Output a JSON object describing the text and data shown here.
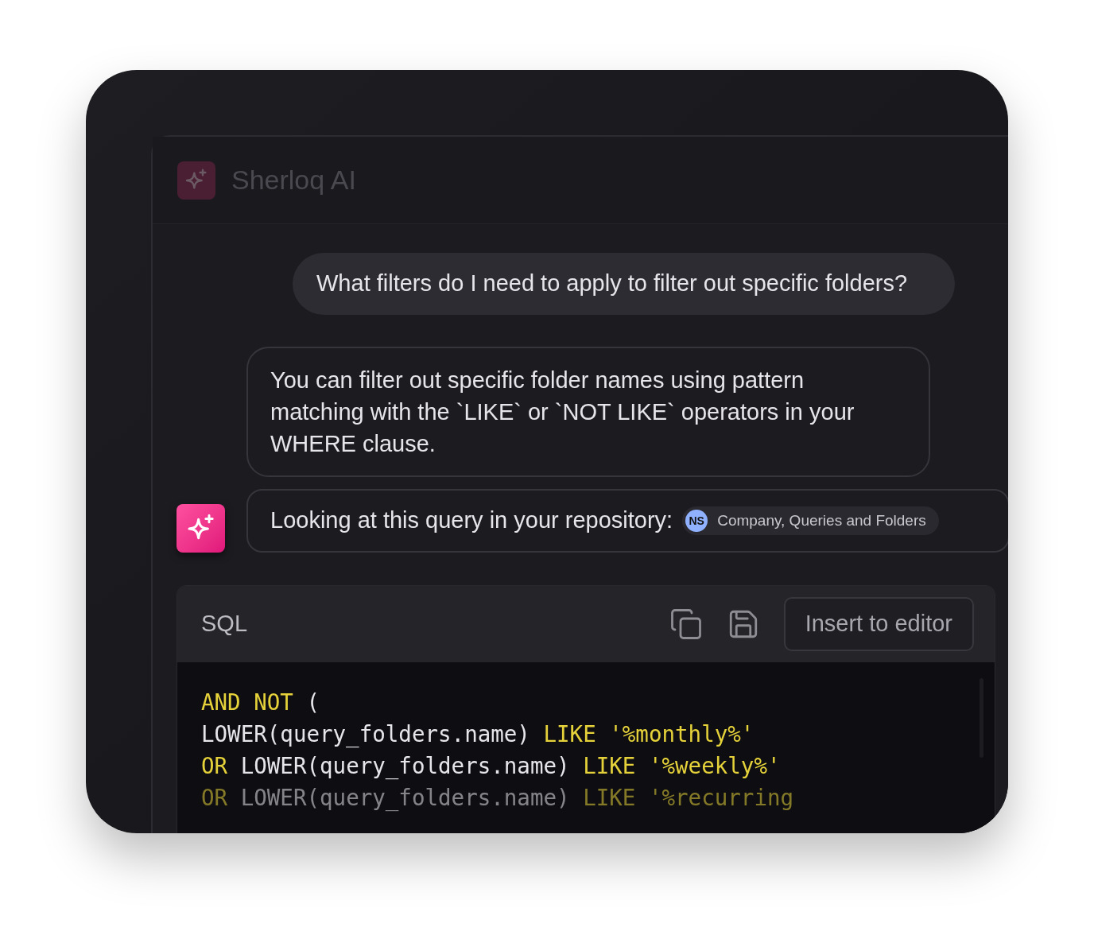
{
  "app": {
    "title": "Sherloq AI"
  },
  "messages": [
    {
      "kind": "user",
      "text": "What filters do I need to apply to filter out specific folders?"
    },
    {
      "kind": "assistant",
      "text": "You can filter out specific folder names using pattern matching with the `LIKE` or `NOT LIKE` operators in your WHERE clause."
    },
    {
      "kind": "assistant",
      "text": "Looking at this query in your repository:",
      "chip": {
        "initials": "NS",
        "label": "Company, Queries and Folders"
      }
    }
  ],
  "code_block": {
    "language": "SQL",
    "actions": [
      {
        "kind": "copy"
      },
      {
        "kind": "save"
      }
    ],
    "button": "Insert to editor",
    "lines": [
      [
        {
          "text": "AND NOT",
          "kind": "keyword"
        },
        {
          "text": " (",
          "kind": "plain"
        }
      ],
      [
        {
          "text": "LOWER(query_folders.name) ",
          "kind": "plain"
        },
        {
          "text": "LIKE '%monthly%'",
          "kind": "keyword"
        }
      ],
      [
        {
          "text": "OR",
          "kind": "keyword"
        },
        {
          "text": " LOWER(query_folders.name) ",
          "kind": "plain"
        },
        {
          "text": "LIKE '%weekly%'",
          "kind": "keyword"
        }
      ],
      [
        {
          "text": "OR",
          "kind": "keyword"
        },
        {
          "text": " LOWER(query_folders.name) ",
          "kind": "plain"
        },
        {
          "text": "LIKE '%recurring",
          "kind": "keyword"
        }
      ]
    ]
  }
}
